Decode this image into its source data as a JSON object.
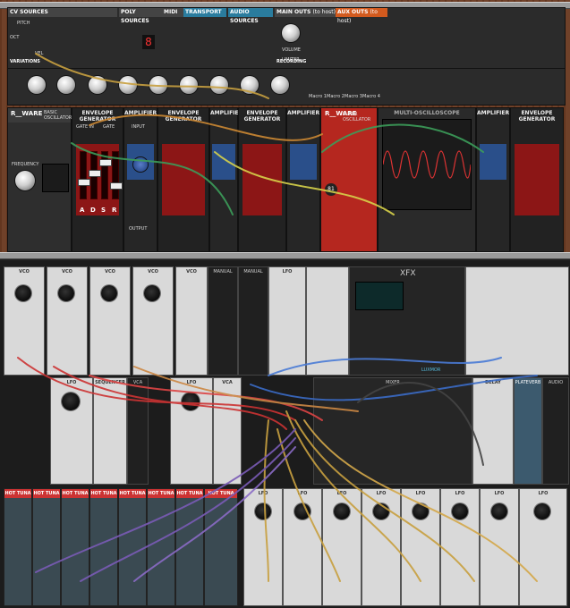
{
  "top_rack": {
    "sections": {
      "cv_sources": "CV SOURCES",
      "poly_sources": "POLY SOURCES",
      "midi": "MIDI",
      "transport": "TRANSPORT",
      "audio_sources": "AUDIO SOURCES",
      "main_outs": "MAIN OUTS",
      "main_outs_sub": "(to host)",
      "aux_outs": "AUX OUTS",
      "aux_outs_sub": "(to host)"
    },
    "row1_labels": {
      "pitch": "PITCH",
      "volume": "VOLUME",
      "limiter": "LIMITER",
      "variations": "VARIATIONS",
      "recording": "RECORDING",
      "oct": "OCT",
      "vel": "VEL"
    },
    "macro_labels": [
      "Macro 1",
      "Macro 2",
      "Macro 3",
      "Macro 4"
    ],
    "modules": [
      {
        "title": "BASIC OSCILLATOR",
        "brand": "R__WARE"
      },
      {
        "title": "ENVELOPE GENERATOR"
      },
      {
        "title": "AMPLIFIER"
      },
      {
        "title": "ENVELOPE GENERATOR"
      },
      {
        "title": "AMPLIFIER"
      },
      {
        "title": "ENVELOPE GENERATOR"
      },
      {
        "title": "AMPLIFIER"
      },
      {
        "title": "SUPER OSCILLATOR",
        "brand": "R__WARE"
      },
      {
        "title": "MULTI-OSCILLOSCOPE"
      },
      {
        "title": "AMPLIFIER"
      },
      {
        "title": "ENVELOPE GENERATOR"
      }
    ],
    "module_labels": {
      "frequency": "FREQUENCY",
      "gate_in": "GATE IN",
      "gate": "GATE",
      "input": "INPUT",
      "cv_amount": "CV AMOUNT",
      "gain": "GAIN",
      "response": "RESPONSE",
      "output": "OUTPUT",
      "adsr": [
        "A",
        "D",
        "S",
        "R"
      ]
    }
  },
  "bottom_rack": {
    "vco_titles": [
      "VCO",
      "VCO",
      "VCO",
      "VCO",
      "VCO",
      "MANUAL",
      "MANUAL",
      "LFO"
    ],
    "xfx_title": "XFX",
    "xfx_brand": "LUXMOR",
    "mid_titles": [
      "LFO",
      "SEQUENCER",
      "VCA",
      "LFO",
      "VCA",
      "MIXER",
      "DELAY",
      "PLATEVERB",
      "AUDIO"
    ],
    "hot_tuna_title": "HOT TUNA",
    "lfo_row_titles": [
      "LFO",
      "LFO",
      "LFO",
      "LFO",
      "LFO",
      "LFO",
      "LFO",
      "LFO"
    ],
    "hot_tuna_count": 8
  }
}
